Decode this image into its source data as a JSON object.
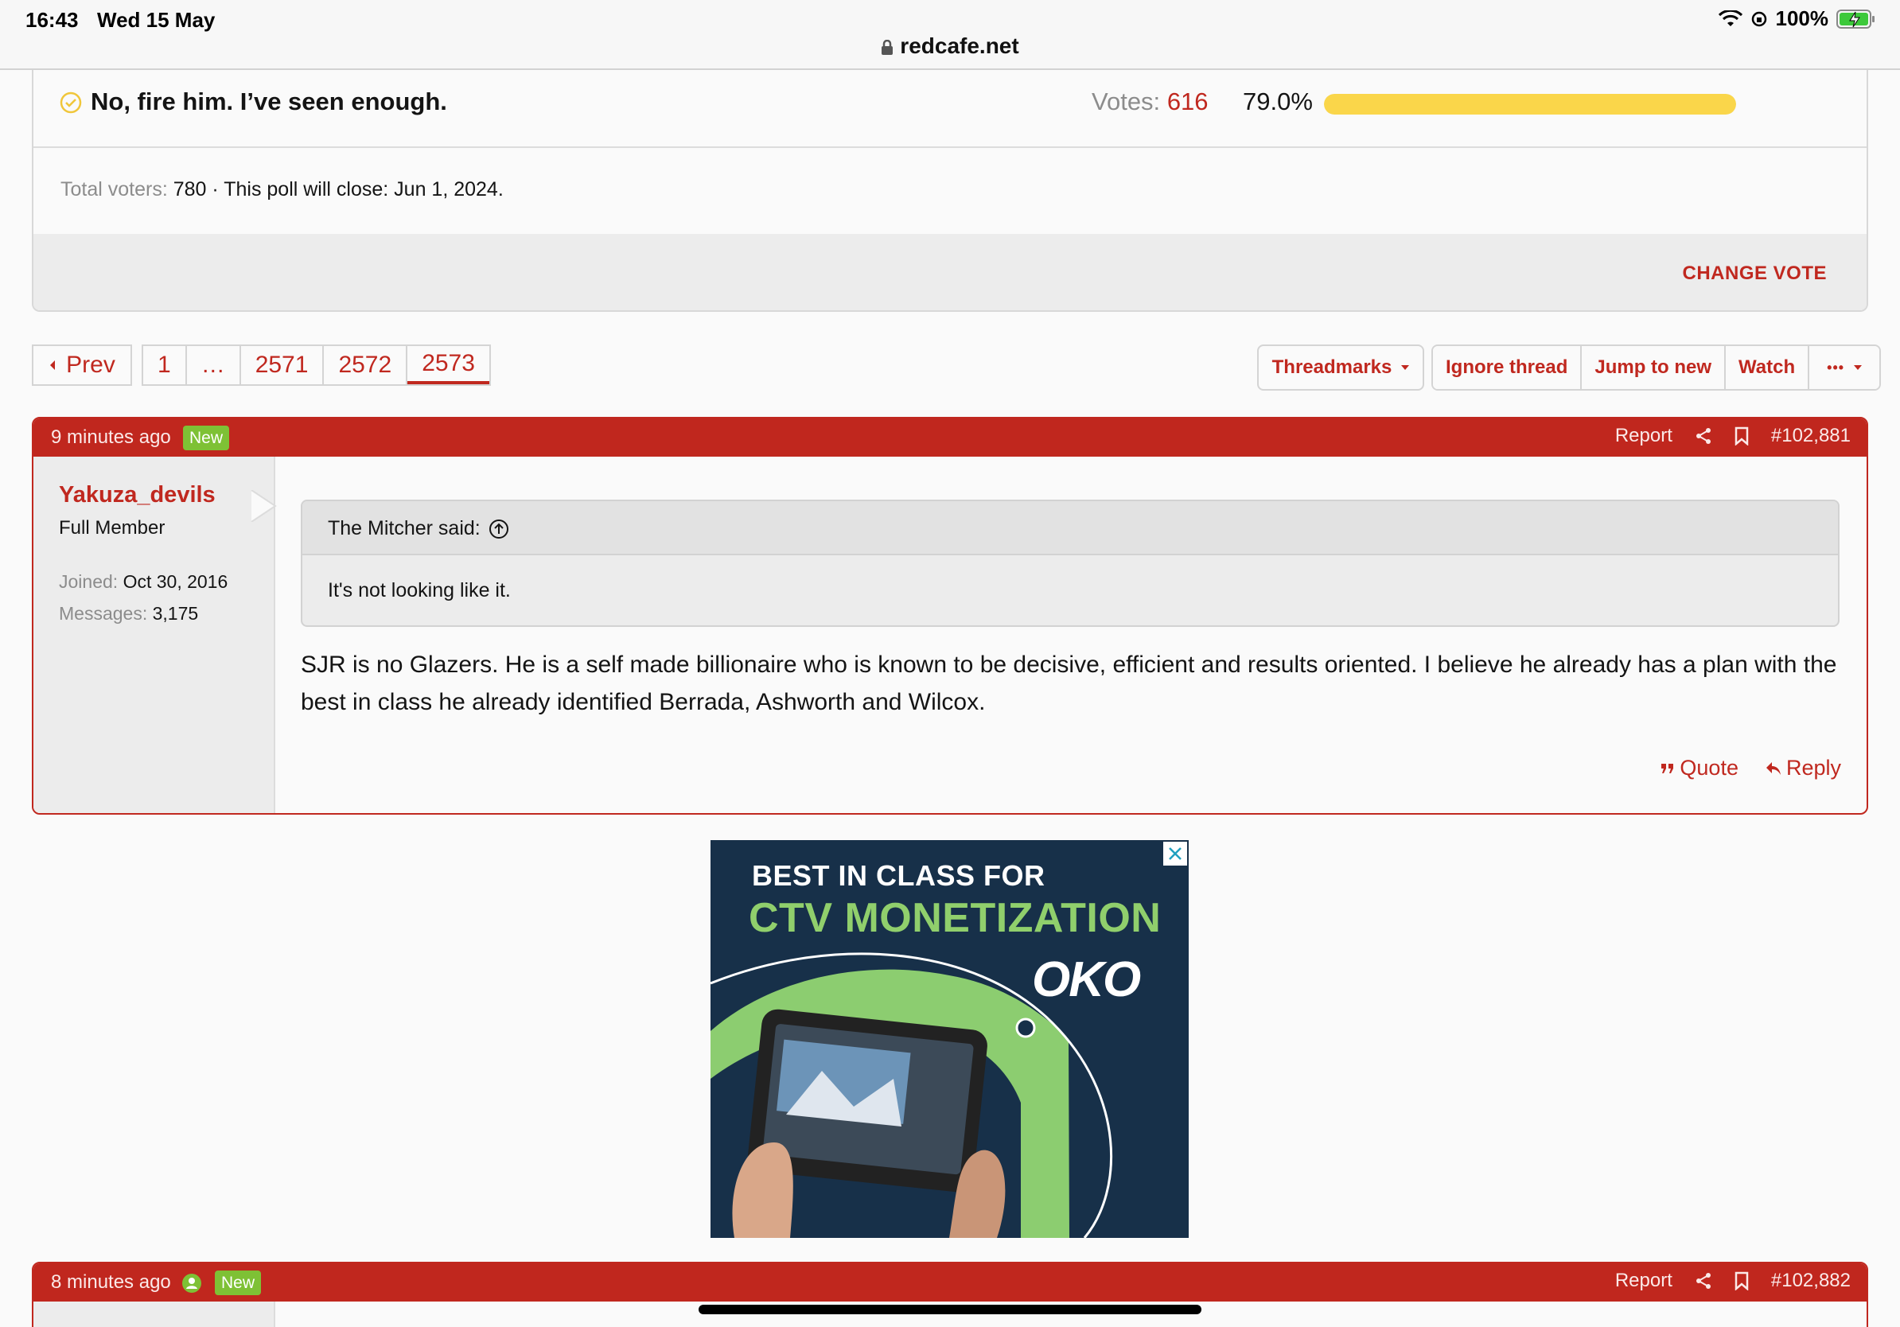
{
  "status_bar": {
    "time": "16:43",
    "date": "Wed 15 May",
    "battery": "100%",
    "url": "redcafe.net"
  },
  "poll": {
    "option_text": "No, fire him. I’ve seen enough.",
    "votes_label": "Votes:",
    "votes_value": "616",
    "percent": "79.0%",
    "bar_fill": 1.0,
    "total_voters_label": "Total voters:",
    "total_voters_value": "780",
    "close_text": " · This poll will close: Jun 1, 2024.",
    "change_vote": "CHANGE VOTE"
  },
  "pagination": {
    "prev": "Prev",
    "pages": [
      "1",
      "…",
      "2571",
      "2572",
      "2573"
    ],
    "current": "2573"
  },
  "thread_actions": {
    "threadmarks": "Threadmarks",
    "ignore": "Ignore thread",
    "jump": "Jump to new",
    "watch": "Watch",
    "more": "•••"
  },
  "post1": {
    "time": "9 minutes ago",
    "badge": "New",
    "report": "Report",
    "number": "#102,881",
    "username": "Yakuza_devils",
    "user_title": "Full Member",
    "joined_label": "Joined:",
    "joined_value": "Oct 30, 2016",
    "messages_label": "Messages:",
    "messages_value": "3,175",
    "quote_author": "The Mitcher said:",
    "quote_text": "It's not looking like it.",
    "body": "SJR is no Glazers. He is a self made billionaire who is known to be decisive, efficient and results oriented. I believe he already has a plan with the best in class he already identified Berrada, Ashworth and Wilcox.",
    "quote_action": "Quote",
    "reply_action": "Reply"
  },
  "ad": {
    "line1": "BEST IN CLASS FOR",
    "line2": "CTV MONETIZATION",
    "logo": "OKO"
  },
  "post2": {
    "time": "8 minutes ago",
    "badge": "New",
    "report": "Report",
    "number": "#102,882"
  },
  "colors": {
    "brand_red": "#c0281f",
    "poll_bar": "#fad64a",
    "new_badge": "#7ec135"
  }
}
